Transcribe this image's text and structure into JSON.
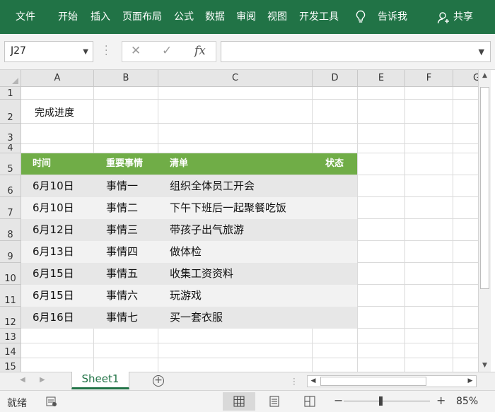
{
  "ribbon": {
    "tabs": [
      {
        "label": "文件"
      },
      {
        "label": "开始"
      },
      {
        "label": "插入"
      },
      {
        "label": "页面布局"
      },
      {
        "label": "公式"
      },
      {
        "label": "数据"
      },
      {
        "label": "审阅"
      },
      {
        "label": "视图"
      },
      {
        "label": "开发工具"
      }
    ],
    "tell_me": "告诉我",
    "share": "共享"
  },
  "formula_bar": {
    "name_box": "J27",
    "cancel_glyph": "✕",
    "enter_glyph": "✓",
    "fx_label": "fx",
    "formula_value": ""
  },
  "columns": [
    "A",
    "B",
    "C",
    "D",
    "E",
    "F",
    "G"
  ],
  "rows": [
    "1",
    "2",
    "3",
    "4",
    "5",
    "6",
    "7",
    "8",
    "9",
    "10",
    "11",
    "12",
    "13",
    "14",
    "15"
  ],
  "sheet": {
    "title_cell": "完成进度",
    "table_header": {
      "time": "时间",
      "item": "重要事情",
      "list": "清单",
      "status": "状态"
    },
    "table_rows": [
      {
        "time": "6月10日",
        "item": "事情一",
        "list": "组织全体员工开会"
      },
      {
        "time": "6月10日",
        "item": "事情二",
        "list": "下午下班后一起聚餐吃饭"
      },
      {
        "time": "6月12日",
        "item": "事情三",
        "list": "带孩子出气旅游"
      },
      {
        "time": "6月13日",
        "item": "事情四",
        "list": "做体检"
      },
      {
        "time": "6月15日",
        "item": "事情五",
        "list": "收集工资资料"
      },
      {
        "time": "6月15日",
        "item": "事情六",
        "list": "玩游戏"
      },
      {
        "time": "6月16日",
        "item": "事情七",
        "list": "买一套衣服"
      }
    ],
    "row_colors": [
      "#e7e7e7",
      "#f2f2f2"
    ],
    "header_color": "#70ad47"
  },
  "sheet_tabs": {
    "active": "Sheet1",
    "add_glyph": "+"
  },
  "status_bar": {
    "ready": "就绪",
    "zoom_minus": "−",
    "zoom_plus": "+",
    "zoom_level": "85%"
  },
  "colors": {
    "ribbon": "#217346",
    "accent": "#70ad47"
  }
}
